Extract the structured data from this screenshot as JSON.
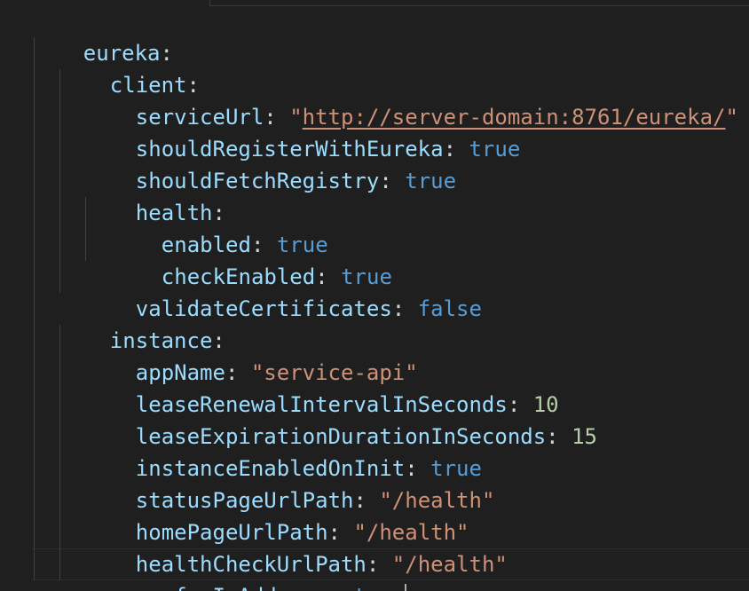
{
  "editor": {
    "lines": [
      {
        "key": "eureka",
        "colon": ":",
        "value": "",
        "vtype": "none"
      },
      {
        "key": "client",
        "colon": ":",
        "value": "",
        "vtype": "none"
      },
      {
        "key": "serviceUrl",
        "colon": ": ",
        "value": "http://server-domain:8761/eureka/",
        "vtype": "url"
      },
      {
        "key": "shouldRegisterWithEureka",
        "colon": ": ",
        "value": "true",
        "vtype": "bool"
      },
      {
        "key": "shouldFetchRegistry",
        "colon": ": ",
        "value": "true",
        "vtype": "bool"
      },
      {
        "key": "health",
        "colon": ":",
        "value": "",
        "vtype": "none"
      },
      {
        "key": "enabled",
        "colon": ": ",
        "value": "true",
        "vtype": "bool"
      },
      {
        "key": "checkEnabled",
        "colon": ": ",
        "value": "true",
        "vtype": "bool"
      },
      {
        "key": "validateCertificates",
        "colon": ": ",
        "value": "false",
        "vtype": "bool"
      },
      {
        "key": "instance",
        "colon": ":",
        "value": "",
        "vtype": "none"
      },
      {
        "key": "appName",
        "colon": ": ",
        "value": "\"service-api\"",
        "vtype": "str"
      },
      {
        "key": "leaseRenewalIntervalInSeconds",
        "colon": ": ",
        "value": "10",
        "vtype": "num"
      },
      {
        "key": "leaseExpirationDurationInSeconds",
        "colon": ": ",
        "value": "15",
        "vtype": "num"
      },
      {
        "key": "instanceEnabledOnInit",
        "colon": ": ",
        "value": "true",
        "vtype": "bool"
      },
      {
        "key": "statusPageUrlPath",
        "colon": ": ",
        "value": "\"/health\"",
        "vtype": "str"
      },
      {
        "key": "homePageUrlPath",
        "colon": ": ",
        "value": "\"/health\"",
        "vtype": "str"
      },
      {
        "key": "healthCheckUrlPath",
        "colon": ": ",
        "value": "\"/health\"",
        "vtype": "str"
      },
      {
        "key": "preferIpAddress",
        "colon": ": ",
        "value": "true",
        "vtype": "bool"
      }
    ],
    "colors": {
      "background": "#1f1f1f",
      "key": "#9cdcfe",
      "boolean": "#569cd6",
      "string": "#ce9178",
      "number": "#b5cea8"
    }
  }
}
